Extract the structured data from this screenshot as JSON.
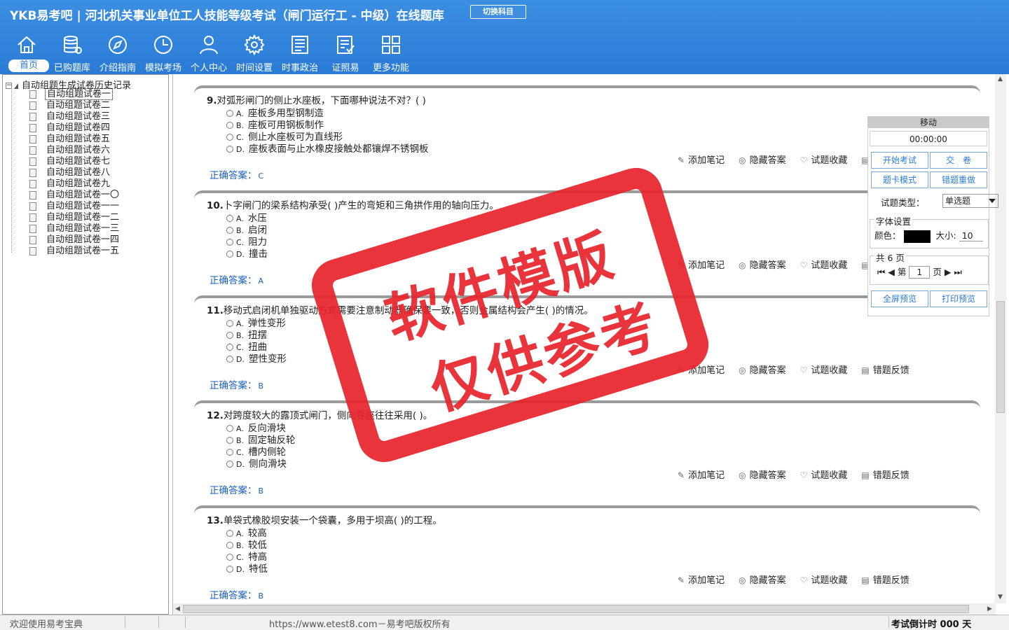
{
  "header": {
    "logo": "YKB易考吧",
    "title": "河北机关事业单位工人技能等级考试（闸门运行工 - 中级）在线题库",
    "switch_label": "切换科目"
  },
  "nav": [
    {
      "label": "首页",
      "icon": "home-icon"
    },
    {
      "label": "已购题库",
      "icon": "database-icon"
    },
    {
      "label": "介绍指南",
      "icon": "compass-icon"
    },
    {
      "label": "模拟考场",
      "icon": "clock-icon"
    },
    {
      "label": "个人中心",
      "icon": "user-icon"
    },
    {
      "label": "时间设置",
      "icon": "gear-icon"
    },
    {
      "label": "时事政治",
      "icon": "newspaper-icon"
    },
    {
      "label": "证照易",
      "icon": "certificate-icon"
    },
    {
      "label": "更多功能",
      "icon": "grid-icon"
    }
  ],
  "tree": {
    "toggle": "−",
    "root": "自动组题生成试卷历史记录",
    "items": [
      "自动组题试卷一",
      "自动组题试卷二",
      "自动组题试卷三",
      "自动组题试卷四",
      "自动组题试卷五",
      "自动组题试卷六",
      "自动组题试卷七",
      "自动组题试卷八",
      "自动组题试卷九",
      "自动组题试卷一〇",
      "自动组题试卷一一",
      "自动组题试卷一二",
      "自动组题试卷一三",
      "自动组题试卷一四",
      "自动组题试卷一五"
    ]
  },
  "questions": [
    {
      "num": "9.",
      "text": "对弧形闸门的侧止水座板，下面哪种说法不对？( )",
      "options": [
        [
          "A.",
          "座板多用型钢制造"
        ],
        [
          "B.",
          "座板可用钢板制作"
        ],
        [
          "C.",
          "侧止水座板可为直线形"
        ],
        [
          "D.",
          "座板表面与止水橡皮接触处都镶焊不锈钢板"
        ]
      ],
      "answer_label": "正确答案：",
      "answer": "C"
    },
    {
      "num": "10.",
      "text": "卜字闸门的梁系结构承受( )产生的弯矩和三角拱作用的轴向压力。",
      "options": [
        [
          "A.",
          "水压"
        ],
        [
          "B.",
          "启闭"
        ],
        [
          "C.",
          "阻力"
        ],
        [
          "D.",
          "撞击"
        ]
      ],
      "answer_label": "正确答案：",
      "answer": "A"
    },
    {
      "num": "11.",
      "text": "移动式启闭机单独驱动方式需要注意制动器确保要一致，否则金属结构会产生( )的情况。",
      "options": [
        [
          "A.",
          "弹性变形"
        ],
        [
          "B.",
          "扭摆"
        ],
        [
          "C.",
          "扭曲"
        ],
        [
          "D.",
          "塑性变形"
        ]
      ],
      "answer_label": "正确答案：",
      "answer": "B"
    },
    {
      "num": "12.",
      "text": "对跨度较大的露顶式闸门，侧向导座往往采用( )。",
      "options": [
        [
          "A.",
          "反向滑块"
        ],
        [
          "B.",
          "固定轴反轮"
        ],
        [
          "C.",
          "槽内侧轮"
        ],
        [
          "D.",
          "侧向滑块"
        ]
      ],
      "answer_label": "正确答案：",
      "answer": "B"
    },
    {
      "num": "13.",
      "text": "单袋式橡胶坝安装一个袋囊，多用于坝高( )的工程。",
      "options": [
        [
          "A.",
          "较高"
        ],
        [
          "B.",
          "较低"
        ],
        [
          "C.",
          "特高"
        ],
        [
          "D.",
          "特低"
        ]
      ],
      "answer_label": "正确答案：",
      "answer": "B"
    }
  ],
  "actions": {
    "note": "添加笔记",
    "hide": "隐藏答案",
    "fav": "试题收藏",
    "report": "错题反馈"
  },
  "panel": {
    "title": "移动",
    "timer": "00:00:00",
    "start": "开始考试",
    "submit": "交　卷",
    "card_mode": "题卡模式",
    "redo": "错题重做",
    "type_label": "试题类型：",
    "type_value": "单选题",
    "font_title": "字体设置",
    "color_label": "颜色：",
    "size_label": "大小:",
    "size_value": "10",
    "pages_title": "共 6 页",
    "page_prefix": "第",
    "page_value": "1",
    "page_suffix": "页",
    "fullscreen": "全屏预览",
    "print": "打印预览"
  },
  "stamp": {
    "line1": "软件模版",
    "line2": "仅供参考"
  },
  "status": {
    "welcome": "欢迎使用易考宝典",
    "copyright": "https://www.etest8.com－易考吧版权所有",
    "countdown": "考试倒计时 000 天"
  }
}
